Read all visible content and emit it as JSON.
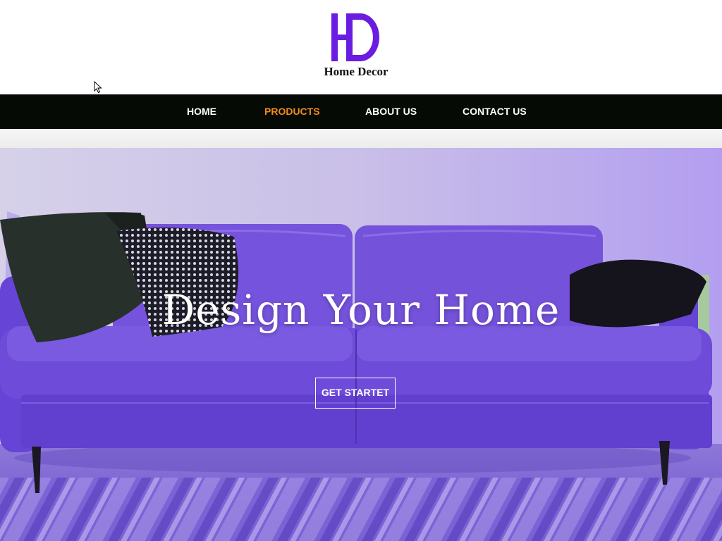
{
  "brand": {
    "logo_letters": "HD",
    "name": "Home Decor",
    "logo_color": "#6a1de0"
  },
  "nav": {
    "items": [
      {
        "label": "HOME",
        "active": false
      },
      {
        "label": "PRODUCTS",
        "active": true
      },
      {
        "label": "ABOUT US",
        "active": false
      },
      {
        "label": "CONTACT US",
        "active": false
      }
    ],
    "active_color": "#f08c1c",
    "background": "#050a05"
  },
  "hero": {
    "title": "Design Your Home",
    "cta_label": "GET STARTET",
    "image": "purple-sofa-photo"
  },
  "cursor": "arrow-pointer-icon"
}
